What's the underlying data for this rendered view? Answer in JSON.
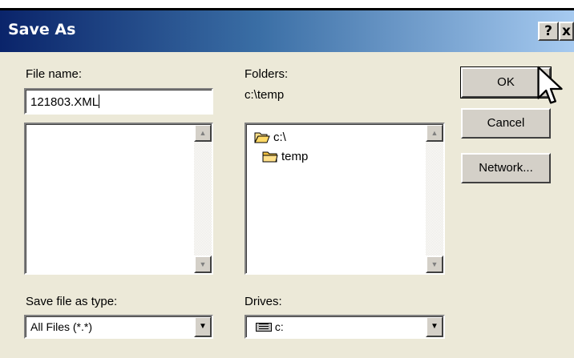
{
  "window": {
    "title": "Save As",
    "help_glyph": "?",
    "close_glyph": "x"
  },
  "file_name": {
    "label": "File name:",
    "value": "121803.XML"
  },
  "folders": {
    "label": "Folders:",
    "path": "c:\\temp",
    "items": [
      "c:\\",
      "temp"
    ]
  },
  "save_type": {
    "label": "Save file as type:",
    "value": "All Files (*.*)"
  },
  "drives": {
    "label": "Drives:",
    "value": "c:"
  },
  "buttons": {
    "ok": "OK",
    "cancel": "Cancel",
    "network": "Network..."
  },
  "colors": {
    "title_start": "#0a246a",
    "title_end": "#a6caf0",
    "dialog_bg": "#ece9d8"
  },
  "icons": [
    "help-icon",
    "close-icon",
    "folder-open-icon",
    "folder-icon",
    "drive-icon",
    "pointer-cursor-icon"
  ]
}
